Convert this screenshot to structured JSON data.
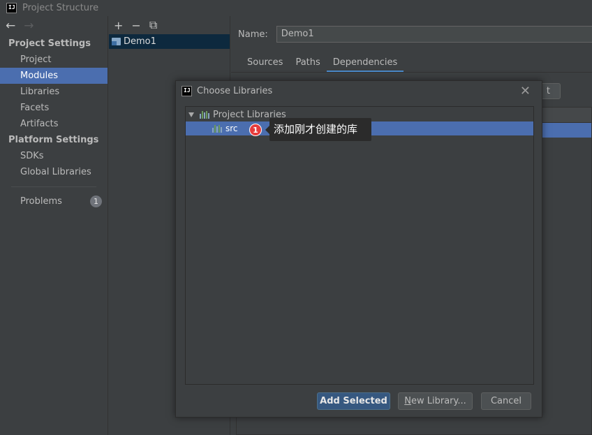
{
  "window": {
    "title": "Project Structure"
  },
  "left_panel": {
    "sections": [
      {
        "header": "Project Settings",
        "items": [
          "Project",
          "Modules",
          "Libraries",
          "Facets",
          "Artifacts"
        ]
      },
      {
        "header": "Platform Settings",
        "items": [
          "SDKs",
          "Global Libraries"
        ]
      }
    ],
    "selected_item": "Modules",
    "problems": {
      "label": "Problems",
      "count": "1"
    }
  },
  "modules": {
    "items": [
      "Demo1"
    ]
  },
  "module_settings": {
    "name_label": "Name:",
    "name_value": "Demo1",
    "tabs": [
      "Sources",
      "Paths",
      "Dependencies"
    ],
    "active_tab": "Dependencies",
    "partial_button_text": "t"
  },
  "dialog": {
    "title": "Choose Libraries",
    "tree": {
      "root_label": "Project Libraries",
      "children": [
        "src"
      ]
    },
    "buttons": {
      "add_selected": "Add Selected",
      "new_library_mnemonic": "N",
      "new_library_rest": "ew Library...",
      "cancel": "Cancel"
    }
  },
  "annotation": {
    "number": "1",
    "text": "添加刚才创建的库"
  },
  "colors": {
    "selection": "#4b6eaf",
    "panel_bg": "#3c3f41",
    "primary_button": "#365880",
    "annotation_red": "#e63c3c"
  }
}
